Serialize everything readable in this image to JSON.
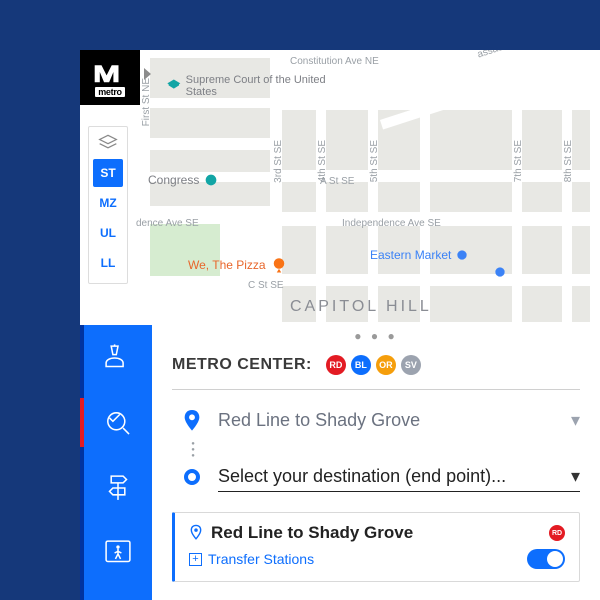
{
  "logo": {
    "text": "metro"
  },
  "layers": {
    "items": [
      {
        "code": "ST",
        "active": true
      },
      {
        "code": "MZ",
        "active": false
      },
      {
        "code": "UL",
        "active": false
      },
      {
        "code": "LL",
        "active": false
      }
    ]
  },
  "map": {
    "neighborhood": "CAPITOL HILL",
    "streets_h": [
      "Constitution Ave NE",
      "A St SE",
      "Independence Ave SE",
      "C St SE"
    ],
    "streets_v": [
      "First St NE",
      "3rd St SE",
      "4th St SE",
      "5th St SE",
      "7th St SE",
      "8th St SE"
    ],
    "diag_label": "Massachusetts Ave NE",
    "poi_supreme": "Supreme Court of the United States",
    "poi_congress": "Congress",
    "poi_pizza": "We, The Pizza",
    "poi_market": "Eastern Market"
  },
  "station": {
    "title_label": "METRO CENTER:",
    "lines": [
      "RD",
      "BL",
      "OR",
      "SV"
    ]
  },
  "directions": {
    "start_label": "Red Line to Shady Grove",
    "end_placeholder": "Select your destination (end point)..."
  },
  "result_card": {
    "title": "Red Line to Shady Grove",
    "line_badge": "RD",
    "transfer_label": "Transfer Stations",
    "toggle_on": true
  },
  "railnav": {
    "active_index": 1
  }
}
